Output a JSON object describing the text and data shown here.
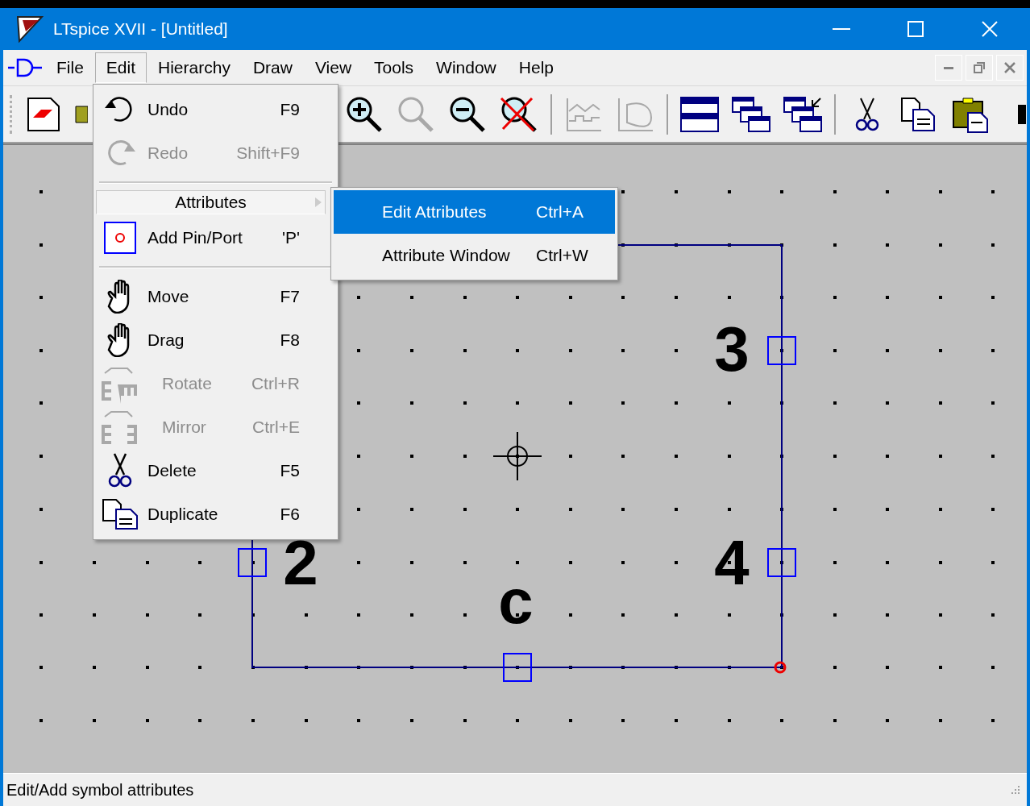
{
  "window": {
    "title": "LTspice XVII - [Untitled]"
  },
  "menu_bar": [
    {
      "label": "File",
      "selected": false
    },
    {
      "label": "Edit",
      "selected": true
    },
    {
      "label": "Hierarchy",
      "selected": false
    },
    {
      "label": "Draw",
      "selected": false
    },
    {
      "label": "View",
      "selected": false
    },
    {
      "label": "Tools",
      "selected": false
    },
    {
      "label": "Window",
      "selected": false
    },
    {
      "label": "Help",
      "selected": false
    }
  ],
  "toolbar": [
    {
      "kind": "button",
      "disabled": false
    },
    {
      "kind": "button",
      "disabled": false
    },
    {
      "kind": "button",
      "disabled": false
    },
    {
      "kind": "button",
      "disabled": true
    },
    {
      "kind": "button",
      "disabled": false
    },
    {
      "kind": "button",
      "disabled": false
    },
    {
      "kind": "separator"
    },
    {
      "kind": "button",
      "disabled": true
    },
    {
      "kind": "button",
      "disabled": true
    },
    {
      "kind": "separator"
    },
    {
      "kind": "button",
      "disabled": false
    },
    {
      "kind": "button",
      "disabled": false
    },
    {
      "kind": "button",
      "disabled": false
    },
    {
      "kind": "separator"
    },
    {
      "kind": "button",
      "disabled": false
    },
    {
      "kind": "button",
      "disabled": false
    },
    {
      "kind": "button",
      "disabled": false
    },
    {
      "kind": "button",
      "disabled": false
    }
  ],
  "edit_menu": [
    {
      "kind": "item",
      "label": "Undo",
      "shortcut": "F9",
      "disabled": false
    },
    {
      "kind": "item",
      "label": "Redo",
      "shortcut": "Shift+F9",
      "disabled": true
    },
    {
      "kind": "separator"
    },
    {
      "kind": "submenu",
      "label": "Attributes",
      "expanded": true
    },
    {
      "kind": "item",
      "label": "Add Pin/Port",
      "shortcut": "'P'",
      "disabled": false
    },
    {
      "kind": "separator"
    },
    {
      "kind": "item",
      "label": "Move",
      "shortcut": "F7",
      "disabled": false
    },
    {
      "kind": "item",
      "label": "Drag",
      "shortcut": "F8",
      "disabled": false
    },
    {
      "kind": "item",
      "label": "Rotate",
      "shortcut": "Ctrl+R",
      "disabled": true
    },
    {
      "kind": "item",
      "label": "Mirror",
      "shortcut": "Ctrl+E",
      "disabled": true
    },
    {
      "kind": "item",
      "label": "Delete",
      "shortcut": "F5",
      "disabled": false
    },
    {
      "kind": "item",
      "label": "Duplicate",
      "shortcut": "F6",
      "disabled": false
    }
  ],
  "attributes_submenu": [
    {
      "label": "Edit Attributes",
      "shortcut": "Ctrl+A",
      "selected": true
    },
    {
      "label": "Attribute Window",
      "shortcut": "Ctrl+W",
      "selected": false
    }
  ],
  "canvas": {
    "pin_labels": [
      "3",
      "2",
      "4",
      "c"
    ]
  },
  "status_bar": {
    "text": "Edit/Add symbol attributes"
  }
}
